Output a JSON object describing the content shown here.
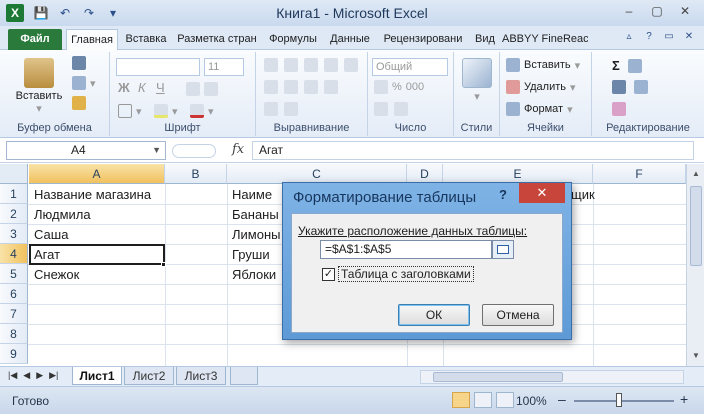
{
  "window": {
    "title": "Книга1 - Microsoft Excel",
    "controls": [
      "–",
      "▢",
      "✕"
    ]
  },
  "ribbon_tabs": [
    "Файл",
    "Главная",
    "Вставка",
    "Разметка стран",
    "Формулы",
    "Данные",
    "Рецензировани",
    "Вид",
    "ABBYY FineReac"
  ],
  "ribbon": {
    "clipboard": {
      "paste": "Вставить",
      "label": "Буфер обмена"
    },
    "font": {
      "size": "11",
      "label": "Шрифт",
      "bold": "Ж",
      "italic": "К",
      "underline": "Ч"
    },
    "alignment": {
      "label": "Выравнивание"
    },
    "number": {
      "format": "Общий",
      "label": "Число",
      "pct": "%",
      "thousands": "000"
    },
    "styles": {
      "label": "Стили"
    },
    "cells": {
      "insert": "Вставить",
      "delete": "Удалить",
      "format": "Формат",
      "label": "Ячейки"
    },
    "editing": {
      "label": "Редактирование"
    }
  },
  "formula_bar": {
    "name_box": "A4",
    "fx": "fx",
    "content": "Агат"
  },
  "columns": [
    "A",
    "B",
    "C",
    "D",
    "E",
    "F"
  ],
  "rows": [
    "1",
    "2",
    "3",
    "4",
    "5",
    "6",
    "7",
    "8",
    "9"
  ],
  "cells": {
    "A1": "Название магазина",
    "A2": "Людмила",
    "A3": "Саша",
    "A4": "Агат",
    "A5": "Снежок",
    "C1": "Наиме",
    "C2": "Бананы",
    "C3": "Лимоны",
    "C4": "Груши",
    "C5": "Яблоки",
    "E1": "щик"
  },
  "sheet_tabs": [
    "Лист1",
    "Лист2",
    "Лист3"
  ],
  "status": {
    "ready": "Готово",
    "zoom": "100%",
    "minus": "–",
    "plus": "+"
  },
  "dialog": {
    "title": "Форматирование таблицы",
    "help": "?",
    "close": "✕",
    "prompt": "Укажите расположение данных таблицы:",
    "range": "=$A$1:$A$5",
    "checkbox_label": "Таблица с заголовками",
    "checkbox_checked": true,
    "checkmark": "✓",
    "ok": "ОК",
    "cancel": "Отмена"
  },
  "colors": {
    "file_tab": "#2a7a3c",
    "dialog_frame": "#5d9ad6",
    "close_button": "#c7453a",
    "selected_header": "#f1c15e"
  }
}
